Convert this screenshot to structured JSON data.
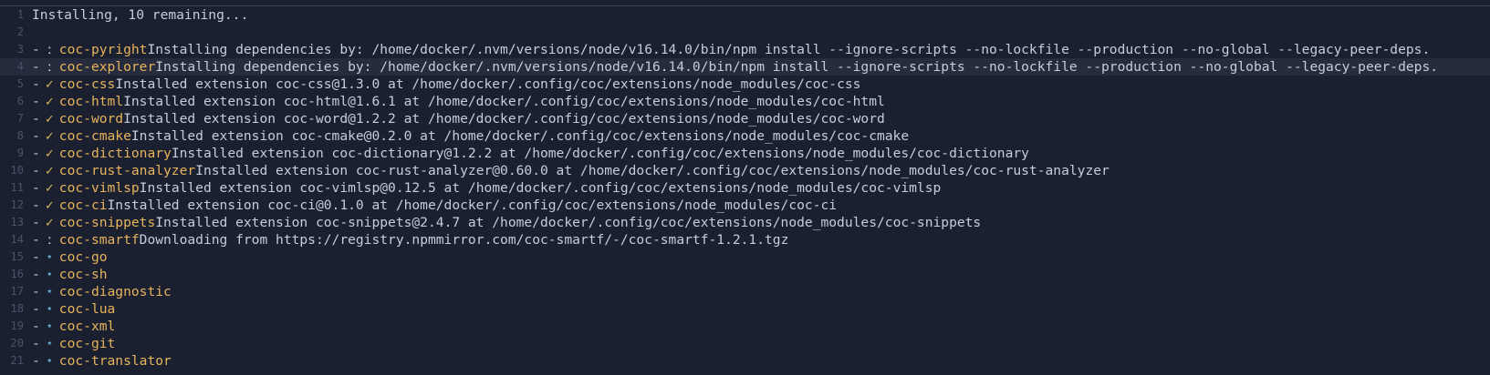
{
  "header": {
    "number": "1",
    "text": "Installing, 10 remaining..."
  },
  "blank": {
    "number": "2"
  },
  "status_glyphs": {
    "done": "✓",
    "progress": "ː",
    "pending": "⋆"
  },
  "colors": {
    "background": "#1b2030",
    "extension_name": "#e7b35c",
    "check": "#d7b661",
    "pending_star": "#6fb3d8",
    "text": "#c8ccd8",
    "line_number": "#4a526a"
  },
  "items": [
    {
      "number": "3",
      "status": "progress",
      "glyph": "ː",
      "name": "coc-pyright",
      "message": "Installing dependencies by: /home/docker/.nvm/versions/node/v16.14.0/bin/npm install --ignore-scripts --no-lockfile --production --no-global --legacy-peer-deps."
    },
    {
      "number": "4",
      "status": "progress",
      "glyph": "ː",
      "name": "coc-explorer",
      "message": "Installing dependencies by: /home/docker/.nvm/versions/node/v16.14.0/bin/npm install --ignore-scripts --no-lockfile --production --no-global --legacy-peer-deps.",
      "current": true
    },
    {
      "number": "5",
      "status": "done",
      "glyph": "✓",
      "name": "coc-css",
      "message": "Installed extension coc-css@1.3.0 at /home/docker/.config/coc/extensions/node_modules/coc-css"
    },
    {
      "number": "6",
      "status": "done",
      "glyph": "✓",
      "name": "coc-html",
      "message": "Installed extension coc-html@1.6.1 at /home/docker/.config/coc/extensions/node_modules/coc-html"
    },
    {
      "number": "7",
      "status": "done",
      "glyph": "✓",
      "name": "coc-word",
      "message": "Installed extension coc-word@1.2.2 at /home/docker/.config/coc/extensions/node_modules/coc-word"
    },
    {
      "number": "8",
      "status": "done",
      "glyph": "✓",
      "name": "coc-cmake",
      "message": "Installed extension coc-cmake@0.2.0 at /home/docker/.config/coc/extensions/node_modules/coc-cmake"
    },
    {
      "number": "9",
      "status": "done",
      "glyph": "✓",
      "name": "coc-dictionary",
      "message": "Installed extension coc-dictionary@1.2.2 at /home/docker/.config/coc/extensions/node_modules/coc-dictionary"
    },
    {
      "number": "10",
      "status": "done",
      "glyph": "✓",
      "name": "coc-rust-analyzer",
      "message": "Installed extension coc-rust-analyzer@0.60.0 at /home/docker/.config/coc/extensions/node_modules/coc-rust-analyzer"
    },
    {
      "number": "11",
      "status": "done",
      "glyph": "✓",
      "name": "coc-vimlsp",
      "message": "Installed extension coc-vimlsp@0.12.5 at /home/docker/.config/coc/extensions/node_modules/coc-vimlsp"
    },
    {
      "number": "12",
      "status": "done",
      "glyph": "✓",
      "name": "coc-ci",
      "message": "Installed extension coc-ci@0.1.0 at /home/docker/.config/coc/extensions/node_modules/coc-ci"
    },
    {
      "number": "13",
      "status": "done",
      "glyph": "✓",
      "name": "coc-snippets",
      "message": "Installed extension coc-snippets@2.4.7 at /home/docker/.config/coc/extensions/node_modules/coc-snippets"
    },
    {
      "number": "14",
      "status": "progress",
      "glyph": "ː",
      "name": "coc-smartf",
      "message": "Downloading from https://registry.npmmirror.com/coc-smartf/-/coc-smartf-1.2.1.tgz"
    },
    {
      "number": "15",
      "status": "pending",
      "glyph": "⋆",
      "name": "coc-go",
      "message": ""
    },
    {
      "number": "16",
      "status": "pending",
      "glyph": "⋆",
      "name": "coc-sh",
      "message": ""
    },
    {
      "number": "17",
      "status": "pending",
      "glyph": "⋆",
      "name": "coc-diagnostic",
      "message": ""
    },
    {
      "number": "18",
      "status": "pending",
      "glyph": "⋆",
      "name": "coc-lua",
      "message": ""
    },
    {
      "number": "19",
      "status": "pending",
      "glyph": "⋆",
      "name": "coc-xml",
      "message": ""
    },
    {
      "number": "20",
      "status": "pending",
      "glyph": "⋆",
      "name": "coc-git",
      "message": ""
    },
    {
      "number": "21",
      "status": "pending",
      "glyph": "⋆",
      "name": "coc-translator",
      "message": ""
    }
  ]
}
